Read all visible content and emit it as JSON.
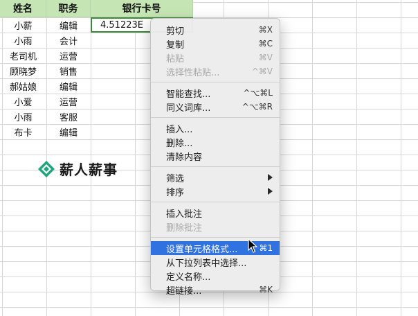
{
  "headers": [
    "姓名",
    "职务",
    "银行卡号"
  ],
  "rows": [
    {
      "name": "小薪",
      "role": "编辑"
    },
    {
      "name": "小雨",
      "role": "会计"
    },
    {
      "name": "老司机",
      "role": "运营"
    },
    {
      "name": "顾晓梦",
      "role": "销售"
    },
    {
      "name": "郝姑娘",
      "role": "编辑"
    },
    {
      "name": "小爱",
      "role": "运营"
    },
    {
      "name": "小雨",
      "role": "客服"
    },
    {
      "name": "布卡",
      "role": "编辑"
    }
  ],
  "selected_cell_value": "4.51223E",
  "logo_text": "薪人薪事",
  "colors": {
    "header_bg": "#c6e5b4",
    "highlight": "#2f72e0",
    "logo_green": "#1fa67a"
  },
  "menu": {
    "group1": [
      {
        "label": "剪切",
        "shortcut": "⌘X",
        "disabled": false
      },
      {
        "label": "复制",
        "shortcut": "⌘C",
        "disabled": false
      },
      {
        "label": "粘贴",
        "shortcut": "⌘V",
        "disabled": true
      },
      {
        "label": "选择性粘贴...",
        "shortcut": "^⌘V",
        "disabled": true
      }
    ],
    "group2": [
      {
        "label": "智能查找...",
        "shortcut": "^⌥⌘L"
      },
      {
        "label": "同义词库...",
        "shortcut": "^⌥⌘R"
      }
    ],
    "group3": [
      {
        "label": "插入..."
      },
      {
        "label": "删除..."
      },
      {
        "label": "清除内容"
      }
    ],
    "group4": [
      {
        "label": "筛选"
      },
      {
        "label": "排序"
      }
    ],
    "group5": [
      {
        "label": "插入批注",
        "disabled": false
      },
      {
        "label": "删除批注",
        "disabled": true
      }
    ],
    "group6": [
      {
        "label": "设置单元格格式...",
        "shortcut": "⌘1",
        "highlighted": true
      },
      {
        "label": "从下拉列表中选择...",
        "shortcut": ""
      },
      {
        "label": "定义名称...",
        "shortcut": ""
      },
      {
        "label": "超链接...",
        "shortcut": "⌘K"
      }
    ]
  }
}
